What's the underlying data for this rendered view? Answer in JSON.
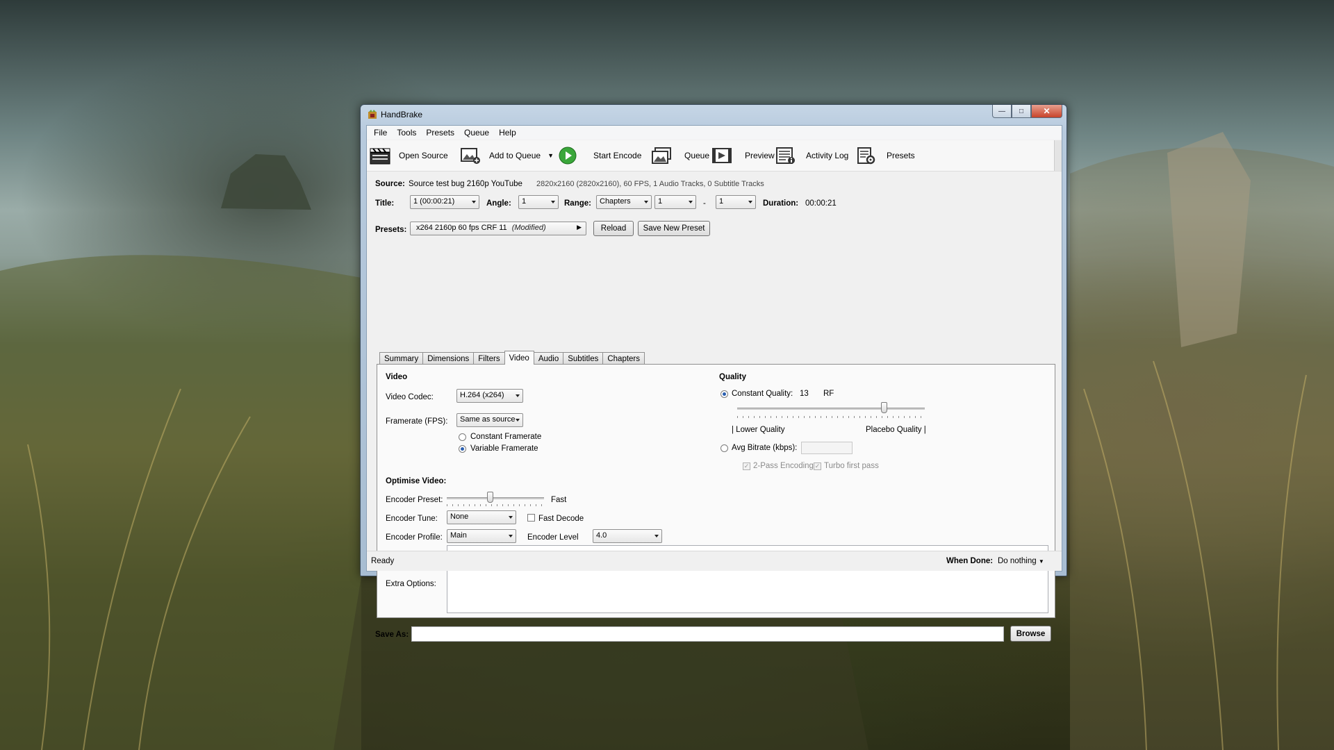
{
  "window": {
    "title": "HandBrake"
  },
  "menu": [
    "File",
    "Tools",
    "Presets",
    "Queue",
    "Help"
  ],
  "toolbar": {
    "open_source": "Open Source",
    "add_to_queue": "Add to Queue",
    "start_encode": "Start Encode",
    "queue": "Queue",
    "preview": "Preview",
    "activity_log": "Activity Log",
    "presets": "Presets"
  },
  "source": {
    "label": "Source:",
    "name": "Source test bug 2160p YouTube",
    "info": "2820x2160 (2820x2160), 60 FPS, 1 Audio Tracks, 0 Subtitle Tracks"
  },
  "title_row": {
    "title_label": "Title:",
    "title_value": "1 (00:00:21)",
    "angle_label": "Angle:",
    "angle_value": "1",
    "range_label": "Range:",
    "range_value": "Chapters",
    "range_start": "1",
    "range_sep": "-",
    "range_end": "1",
    "duration_label": "Duration:",
    "duration_value": "00:00:21"
  },
  "presets": {
    "label": "Presets:",
    "value": "x264 2160p 60 fps CRF 11",
    "modified": "(Modified)",
    "reload": "Reload",
    "save_new": "Save New Preset"
  },
  "tabs": [
    "Summary",
    "Dimensions",
    "Filters",
    "Video",
    "Audio",
    "Subtitles",
    "Chapters"
  ],
  "active_tab": "Video",
  "video": {
    "heading": "Video",
    "codec_label": "Video Codec:",
    "codec_value": "H.264 (x264)",
    "framerate_label": "Framerate (FPS):",
    "framerate_value": "Same as source",
    "constant_framerate": "Constant Framerate",
    "variable_framerate": "Variable Framerate",
    "selected_framerate_mode": "Variable Framerate"
  },
  "quality": {
    "heading": "Quality",
    "constant_quality_label": "Constant Quality:",
    "cq_value": "13",
    "cq_unit": "RF",
    "slider_fraction": 0.78,
    "lower_quality": "| Lower Quality",
    "placebo_quality": "Placebo Quality |",
    "avg_bitrate_label": "Avg Bitrate (kbps):",
    "two_pass": "2-Pass Encoding",
    "turbo_first_pass": "Turbo first pass",
    "selected_mode": "Constant Quality"
  },
  "optimise": {
    "heading": "Optimise Video:",
    "preset_label": "Encoder Preset:",
    "preset_value": "Fast",
    "preset_slider_fraction": 0.44,
    "tune_label": "Encoder Tune:",
    "tune_value": "None",
    "fast_decode": "Fast Decode",
    "profile_label": "Encoder Profile:",
    "profile_value": "Main",
    "level_label": "Encoder Level",
    "level_value": "4.0",
    "extra_options_label": "Extra Options:"
  },
  "save": {
    "label": "Save As:",
    "browse": "Browse"
  },
  "status": {
    "text": "Ready",
    "when_done_label": "When Done:",
    "when_done_value": "Do nothing"
  },
  "colors": {
    "start_encode_green": "#3aa73a",
    "radio_accent": "#2a5fb0"
  }
}
